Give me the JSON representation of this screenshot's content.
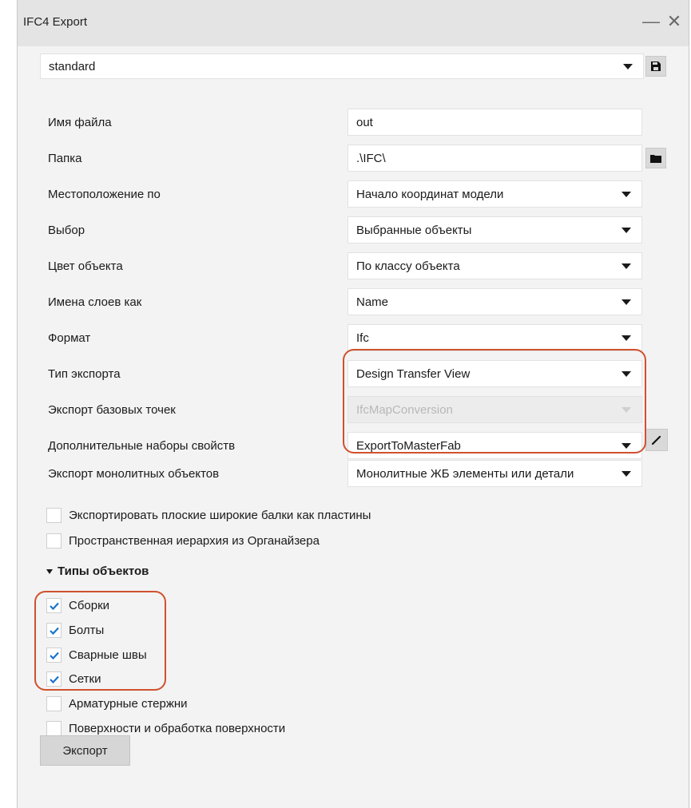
{
  "window": {
    "title": "IFC4 Export",
    "minimize_glyph": "—",
    "close_glyph": "✕"
  },
  "preset": {
    "value": "standard",
    "save_icon": "save-icon"
  },
  "fields": [
    {
      "label": "Имя файла",
      "value": "out",
      "type": "text"
    },
    {
      "label": "Папка",
      "value": ".\\IFC\\",
      "type": "text",
      "side_icon": "folder-icon"
    },
    {
      "label": "Местоположение по",
      "value": "Начало координат модели",
      "type": "select"
    },
    {
      "label": "Выбор",
      "value": "Выбранные объекты",
      "type": "select"
    },
    {
      "label": "Цвет объекта",
      "value": "По классу объекта",
      "type": "select"
    },
    {
      "label": "Имена слоев как",
      "value": "Name",
      "type": "select"
    },
    {
      "label": "Формат",
      "value": "Ifc",
      "type": "select"
    },
    {
      "label": "Тип экспорта",
      "value": "Design Transfer View",
      "type": "select"
    },
    {
      "label": "Экспорт базовых точек",
      "value": "IfcMapConversion",
      "type": "select",
      "disabled": true
    },
    {
      "label": "Дополнительные наборы свойств",
      "value": "ExportToMasterFab",
      "type": "select",
      "side_icon": "pencil-icon"
    },
    {
      "label": "Экспорт монолитных объектов",
      "value": "Монолитные ЖБ элементы или детали",
      "type": "select"
    }
  ],
  "options": [
    {
      "label": "Экспортировать плоские широкие балки как пластины",
      "checked": false
    },
    {
      "label": "Пространственная иерархия из Органайзера",
      "checked": false
    }
  ],
  "object_types": {
    "title": "Типы объектов",
    "items": [
      {
        "label": "Сборки",
        "checked": true
      },
      {
        "label": "Болты",
        "checked": true
      },
      {
        "label": "Сварные швы",
        "checked": true
      },
      {
        "label": "Сетки",
        "checked": true
      },
      {
        "label": "Арматурные стержни",
        "checked": false
      },
      {
        "label": "Поверхности и обработка поверхности",
        "checked": false
      }
    ]
  },
  "export_button": "Экспорт",
  "colors": {
    "highlight": "#d0512e",
    "check": "#1a73c8"
  }
}
